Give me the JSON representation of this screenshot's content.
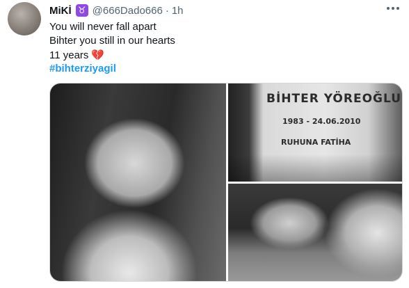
{
  "tweet": {
    "author_name": "MiKİ",
    "zodiac_symbol": "♉",
    "handle": "@666Dado666",
    "separator": "·",
    "time": "1h",
    "lines": [
      "You will never fall apart",
      "Bihter you still in our hearts",
      "11 years"
    ],
    "heart_emoji": "💔",
    "hashtag": "#bihterziyagil"
  },
  "media": {
    "images": [
      {
        "description_icon": "photo-woman-on-phone"
      },
      {
        "description_icon": "photo-gravestone",
        "engraved_lines": [
          "BİHTER YÖREOĞLU",
          "1983 - 24.06.2010",
          "RUHUNA FATİHA"
        ]
      },
      {
        "description_icon": "photo-woman-lying-down"
      }
    ]
  },
  "colors": {
    "text": "#0f1419",
    "secondary": "#536471",
    "link": "#1d9bf0",
    "zodiac_badge": "#8e49e6"
  }
}
